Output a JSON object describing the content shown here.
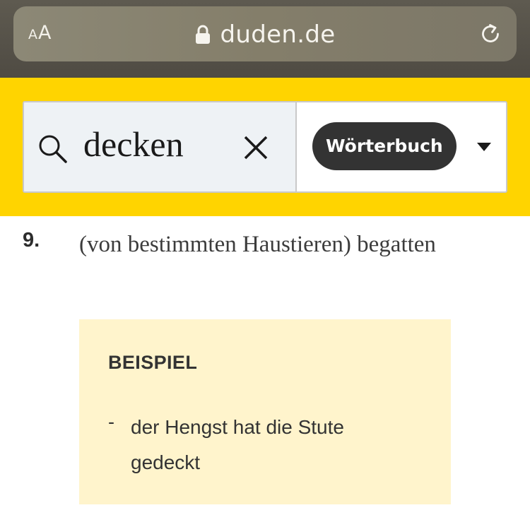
{
  "browser": {
    "text_size_small": "A",
    "text_size_large": "A",
    "url": "duden.de",
    "icons": [
      "text-size-icon",
      "lock-icon",
      "reload-icon"
    ]
  },
  "search": {
    "query": "decken",
    "dictionary_button": "Wörterbuch",
    "icons": [
      "search-icon",
      "clear-icon",
      "dropdown-arrow-icon"
    ]
  },
  "definition": {
    "number": "9.",
    "text": "(von bestimmten Haustieren) begatten",
    "example": {
      "heading": "BEISPIEL",
      "bullet": "-",
      "text": "der Hengst hat die Stute gedeckt"
    }
  },
  "colors": {
    "header_yellow": "#ffd400",
    "example_background": "#fff4cc",
    "pill_dark": "#333333",
    "search_field_bg": "#eef2f5"
  }
}
